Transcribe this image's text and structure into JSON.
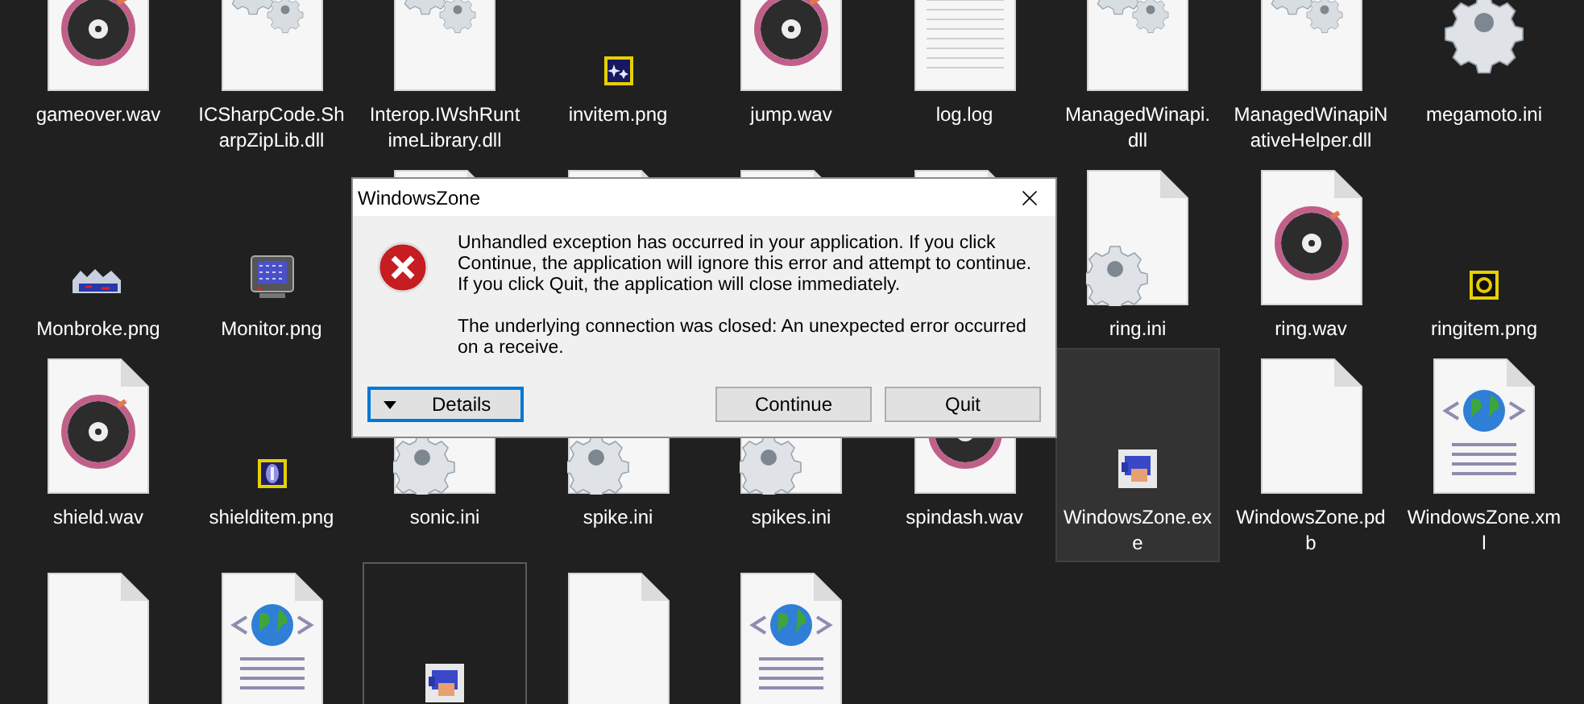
{
  "files": [
    {
      "label": "gameover.wav",
      "kind": "audio",
      "selected": false,
      "focused": false
    },
    {
      "label": "ICSharpCode.SharpZipLib.dll",
      "kind": "library",
      "selected": false,
      "focused": false
    },
    {
      "label": "Interop.IWshRuntimeLibrary.dll",
      "kind": "library",
      "selected": false,
      "focused": false
    },
    {
      "label": "invitem.png",
      "kind": "sparkle-image",
      "selected": false,
      "focused": false
    },
    {
      "label": "jump.wav",
      "kind": "audio",
      "selected": false,
      "focused": false
    },
    {
      "label": "log.log",
      "kind": "text",
      "selected": false,
      "focused": false
    },
    {
      "label": "ManagedWinapi.dll",
      "kind": "library",
      "selected": false,
      "focused": false
    },
    {
      "label": "ManagedWinapiNativeHelper.dll",
      "kind": "library",
      "selected": false,
      "focused": false
    },
    {
      "label": "megamoto.ini",
      "kind": "gear",
      "selected": false,
      "focused": false
    },
    {
      "label": "Monbroke.png",
      "kind": "broken-image",
      "selected": false,
      "focused": false
    },
    {
      "label": "Monitor.png",
      "kind": "monitor-image",
      "selected": false,
      "focused": false
    },
    {
      "kind": "document",
      "selected": false,
      "focused": false
    },
    {
      "kind": "document",
      "selected": false,
      "focused": false
    },
    {
      "kind": "document",
      "selected": false,
      "focused": false
    },
    {
      "kind": "document",
      "selected": false,
      "focused": false
    },
    {
      "label": "ring.ini",
      "kind": "settings",
      "selected": false,
      "focused": false
    },
    {
      "label": "ring.wav",
      "kind": "audio",
      "selected": false,
      "focused": false
    },
    {
      "label": "ringitem.png",
      "kind": "ring-image",
      "selected": false,
      "focused": false
    },
    {
      "label": "shield.wav",
      "kind": "audio",
      "selected": false,
      "focused": false
    },
    {
      "label": "shielditem.png",
      "kind": "shield-image",
      "selected": false,
      "focused": false
    },
    {
      "label": "sonic.ini",
      "kind": "settings",
      "selected": false,
      "focused": false
    },
    {
      "label": "spike.ini",
      "kind": "settings",
      "selected": false,
      "focused": false
    },
    {
      "label": "spikes.ini",
      "kind": "settings",
      "selected": false,
      "focused": false
    },
    {
      "label": "spindash.wav",
      "kind": "audio",
      "selected": false,
      "focused": false
    },
    {
      "label": "WindowsZone.exe",
      "kind": "sprite",
      "selected": true,
      "focused": false
    },
    {
      "label": "WindowsZone.pdb",
      "kind": "document",
      "selected": false,
      "focused": false
    },
    {
      "label": "WindowsZone.xml",
      "kind": "web",
      "selected": false,
      "focused": false
    },
    {
      "kind": "document",
      "selected": false,
      "focused": false
    },
    {
      "kind": "web",
      "selected": false,
      "focused": false
    },
    {
      "kind": "sprite",
      "selected": false,
      "focused": true
    },
    {
      "kind": "document",
      "selected": false,
      "focused": false
    },
    {
      "kind": "web",
      "selected": false,
      "focused": false
    }
  ],
  "dialog": {
    "title": "WindowsZone",
    "message": "Unhandled exception has occurred in your application. If you click Continue, the application will ignore this error and attempt to continue. If you click Quit, the application will close immediately.",
    "detail": "The underlying connection was closed: An unexpected error occurred on a receive.",
    "buttons": [
      {
        "label": "Details",
        "kind": "expander",
        "focused": true
      },
      {
        "label": "Continue",
        "kind": "push",
        "focused": false
      },
      {
        "label": "Quit",
        "kind": "push",
        "focused": false
      }
    ]
  }
}
